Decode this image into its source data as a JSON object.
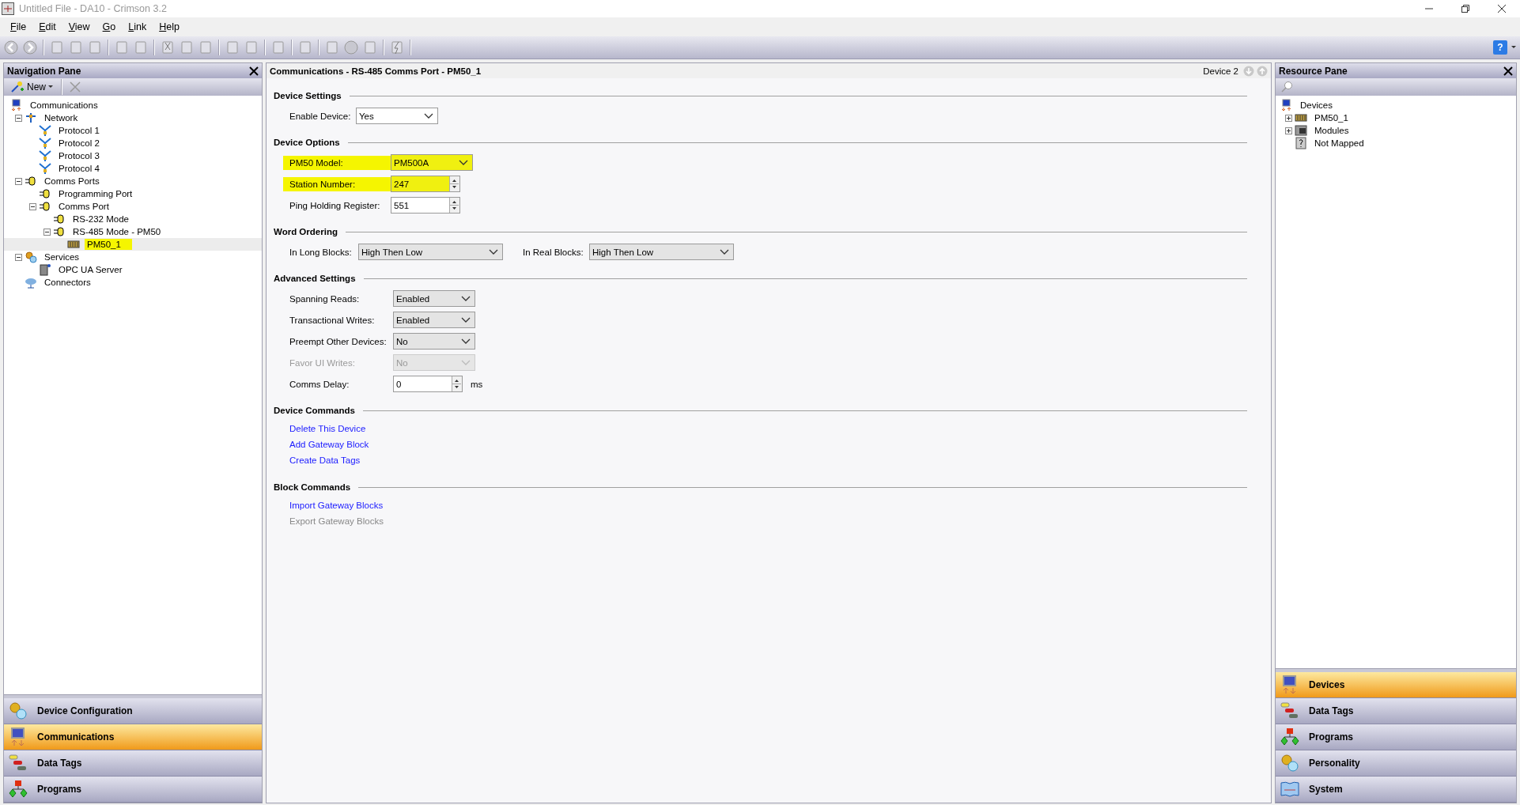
{
  "window": {
    "title": "Untitled File - DA10 - Crimson 3.2"
  },
  "menu": [
    "File",
    "Edit",
    "View",
    "Go",
    "Link",
    "Help"
  ],
  "help": "?",
  "nav_pane": {
    "title": "Navigation Pane",
    "new_button": "New",
    "tree": [
      {
        "label": "Communications",
        "kind": "devices",
        "selected": false,
        "highlighted": false,
        "children": [
          {
            "label": "Network",
            "kind": "network",
            "expanded": true,
            "selected": false,
            "highlighted": false,
            "children": [
              {
                "label": "Protocol 1",
                "kind": "protocol",
                "selected": false,
                "highlighted": false
              },
              {
                "label": "Protocol 2",
                "kind": "protocol",
                "selected": false,
                "highlighted": false
              },
              {
                "label": "Protocol 3",
                "kind": "protocol",
                "selected": false,
                "highlighted": false
              },
              {
                "label": "Protocol 4",
                "kind": "protocol",
                "selected": false,
                "highlighted": false
              }
            ]
          },
          {
            "label": "Comms Ports",
            "kind": "port",
            "expanded": true,
            "selected": false,
            "highlighted": false,
            "children": [
              {
                "label": "Programming Port",
                "kind": "port",
                "selected": false,
                "highlighted": false
              },
              {
                "label": "Comms Port",
                "kind": "port",
                "expanded": true,
                "selected": false,
                "highlighted": false,
                "children": [
                  {
                    "label": "RS-232 Mode",
                    "kind": "port",
                    "selected": false,
                    "highlighted": false
                  },
                  {
                    "label": "RS-485 Mode - PM50",
                    "kind": "port",
                    "expanded": true,
                    "selected": false,
                    "highlighted": false,
                    "children": [
                      {
                        "label": "PM50_1",
                        "kind": "device",
                        "selected": true,
                        "highlighted": true
                      }
                    ]
                  }
                ]
              }
            ]
          },
          {
            "label": "Services",
            "kind": "gears",
            "expanded": true,
            "selected": false,
            "highlighted": false,
            "children": [
              {
                "label": "OPC UA Server",
                "kind": "server",
                "selected": false,
                "highlighted": false
              }
            ]
          },
          {
            "label": "Connectors",
            "kind": "cloud",
            "selected": false,
            "highlighted": false
          }
        ]
      }
    ],
    "bottom_buttons": [
      {
        "label": "Device Configuration",
        "kind": "gears",
        "selected": false
      },
      {
        "label": "Communications",
        "kind": "devices",
        "selected": true
      },
      {
        "label": "Data Tags",
        "kind": "tags",
        "selected": false
      },
      {
        "label": "Programs",
        "kind": "programs",
        "selected": false
      }
    ]
  },
  "main": {
    "title": "Communications - RS-485 Comms Port - PM50_1",
    "device_label": "Device 2",
    "sections": [
      {
        "title": "Device Settings",
        "kind": "form",
        "rows": [
          {
            "kind": "dropdown",
            "label": "Enable Device:",
            "value": "Yes",
            "disabled": false,
            "highlighted": false
          }
        ]
      },
      {
        "title": "Device Options",
        "kind": "form",
        "rows": [
          {
            "kind": "combo",
            "label": "PM50 Model:",
            "value": "PM500A",
            "disabled": false,
            "highlighted": true
          },
          {
            "kind": "spin",
            "label": "Station Number:",
            "value": "247",
            "disabled": false,
            "highlighted": true
          },
          {
            "kind": "spin",
            "label": "Ping Holding Register:",
            "value": "551",
            "disabled": false,
            "highlighted": false
          }
        ]
      },
      {
        "title": "Word Ordering",
        "kind": "pair",
        "rows": [
          {
            "kind": "combo",
            "label": "In Long Blocks:",
            "value": "High Then Low",
            "disabled": false,
            "highlighted": false
          },
          {
            "kind": "combo",
            "label": "In Real Blocks:",
            "value": "High Then Low",
            "disabled": false,
            "highlighted": false
          }
        ]
      },
      {
        "title": "Advanced Settings",
        "kind": "form",
        "rows": [
          {
            "kind": "combo",
            "label": "Spanning Reads:",
            "value": "Enabled",
            "disabled": false,
            "highlighted": false
          },
          {
            "kind": "combo",
            "label": "Transactional Writes:",
            "value": "Enabled",
            "disabled": false,
            "highlighted": false
          },
          {
            "kind": "combo",
            "label": "Preempt Other Devices:",
            "value": "No",
            "disabled": false,
            "highlighted": false
          },
          {
            "kind": "combo",
            "label": "Favor UI Writes:",
            "value": "No",
            "disabled": true,
            "highlighted": false
          },
          {
            "kind": "spin",
            "label": "Comms Delay:",
            "value": "0",
            "unit": "ms",
            "disabled": false,
            "highlighted": false
          }
        ]
      },
      {
        "title": "Device Commands",
        "kind": "links",
        "links": [
          {
            "label": "Delete This Device",
            "disabled": false
          },
          {
            "label": "Add Gateway Block",
            "disabled": false
          },
          {
            "label": "Create Data Tags",
            "disabled": false
          }
        ]
      },
      {
        "title": "Block Commands",
        "kind": "links",
        "links": [
          {
            "label": "Import Gateway Blocks",
            "disabled": false
          },
          {
            "label": "Export Gateway Blocks",
            "disabled": true
          }
        ]
      }
    ]
  },
  "resource_pane": {
    "title": "Resource Pane",
    "tree": [
      {
        "label": "Devices",
        "kind": "devices",
        "selected": false,
        "highlighted": false,
        "children": [
          {
            "label": "PM50_1",
            "kind": "device",
            "expanded": false,
            "selected": false,
            "highlighted": false
          },
          {
            "label": "Modules",
            "kind": "modules",
            "expanded": false,
            "selected": false,
            "highlighted": false
          },
          {
            "label": "Not Mapped",
            "kind": "unknown",
            "selected": false,
            "highlighted": false
          }
        ]
      }
    ],
    "bottom_buttons": [
      {
        "label": "Devices",
        "kind": "devices",
        "selected": true
      },
      {
        "label": "Data Tags",
        "kind": "tags",
        "selected": false
      },
      {
        "label": "Programs",
        "kind": "programs",
        "selected": false
      },
      {
        "label": "Personality",
        "kind": "gears",
        "selected": false
      },
      {
        "label": "System",
        "kind": "system",
        "selected": false
      }
    ]
  }
}
